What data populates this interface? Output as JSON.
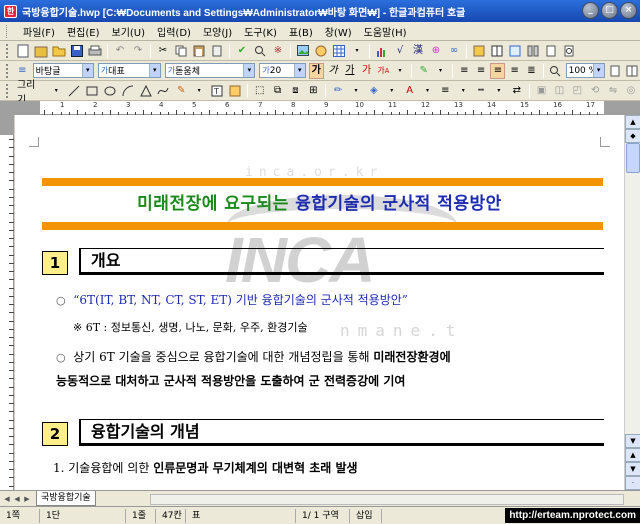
{
  "window": {
    "title": "국방융합기술.hwp [C:₩Documents and Settings₩Administrator₩바탕 화면₩] - 한글과컴퓨터 호글",
    "app_icon": "한"
  },
  "menu": [
    "파일(F)",
    "편집(E)",
    "보기(U)",
    "입력(D)",
    "모양(J)",
    "도구(K)",
    "표(B)",
    "창(W)",
    "도움말(H)"
  ],
  "format_toolbar": {
    "style": "바탕글",
    "lang": "대표",
    "font": "돋움체",
    "size": "20",
    "zoom": "100 %",
    "bold_glyph": "가",
    "italic_glyph": "가",
    "underline_glyph": "가",
    "color_glyph": "가",
    "highlight_glyph": "가"
  },
  "draw_toolbar": {
    "label": "그리기"
  },
  "ruler": {
    "numbers": [
      "1",
      "2",
      "3",
      "4",
      "5",
      "6",
      "7",
      "8",
      "9",
      "10",
      "11",
      "12",
      "13",
      "14",
      "15",
      "16",
      "17"
    ]
  },
  "document": {
    "title_green": "미래전장에 요구되는",
    "title_blue": "융합기술의 군사적 적용방안",
    "watermark": "INCA",
    "watermark_url_top": "inca.or.kr",
    "watermark_url_mid": "nmane.t",
    "sec1": {
      "num": "1",
      "title": "개요"
    },
    "bullet1": "“6T(IT, BT, NT, CT, ST, ET) 기반 융합기술의 군사적 적용방안”",
    "note1": "※ 6T : 정보통신, 생명, 나노, 문화, 우주, 환경기술",
    "bullet2_line1_a": "상기 6T 기술을 중심으로 융합기술에 대한 개념정립을 통해 ",
    "bullet2_line1_b": "미래전장환경에",
    "bullet2_line2_a": "능동적으로 ",
    "bullet2_line2_b": "대처하고 군사적 적용방안을 도출하여 군 전력증강에 기여",
    "sec2": {
      "num": "2",
      "title": "융합기술의 개념"
    },
    "item1_a": "1. 기술융합에 의한 ",
    "item1_b": "인류문명과 무기체계의 대변혁 초래 발생"
  },
  "tabs": {
    "sheet": "국방융합기술"
  },
  "status": {
    "page": "1쪽",
    "section": "1단",
    "line": "1줄",
    "column": "47칸",
    "mode": "표",
    "page_of": "1/ 1 구역",
    "insert": "삽입"
  },
  "url_watermark": "http://erteam.nprotect.com",
  "colors": {
    "orange": "#f29400",
    "title_green": "#1a8a1a",
    "title_blue": "#1d2bb0",
    "section_num_bg": "#ffef8a",
    "quote_blue": "#1d2bb0"
  }
}
